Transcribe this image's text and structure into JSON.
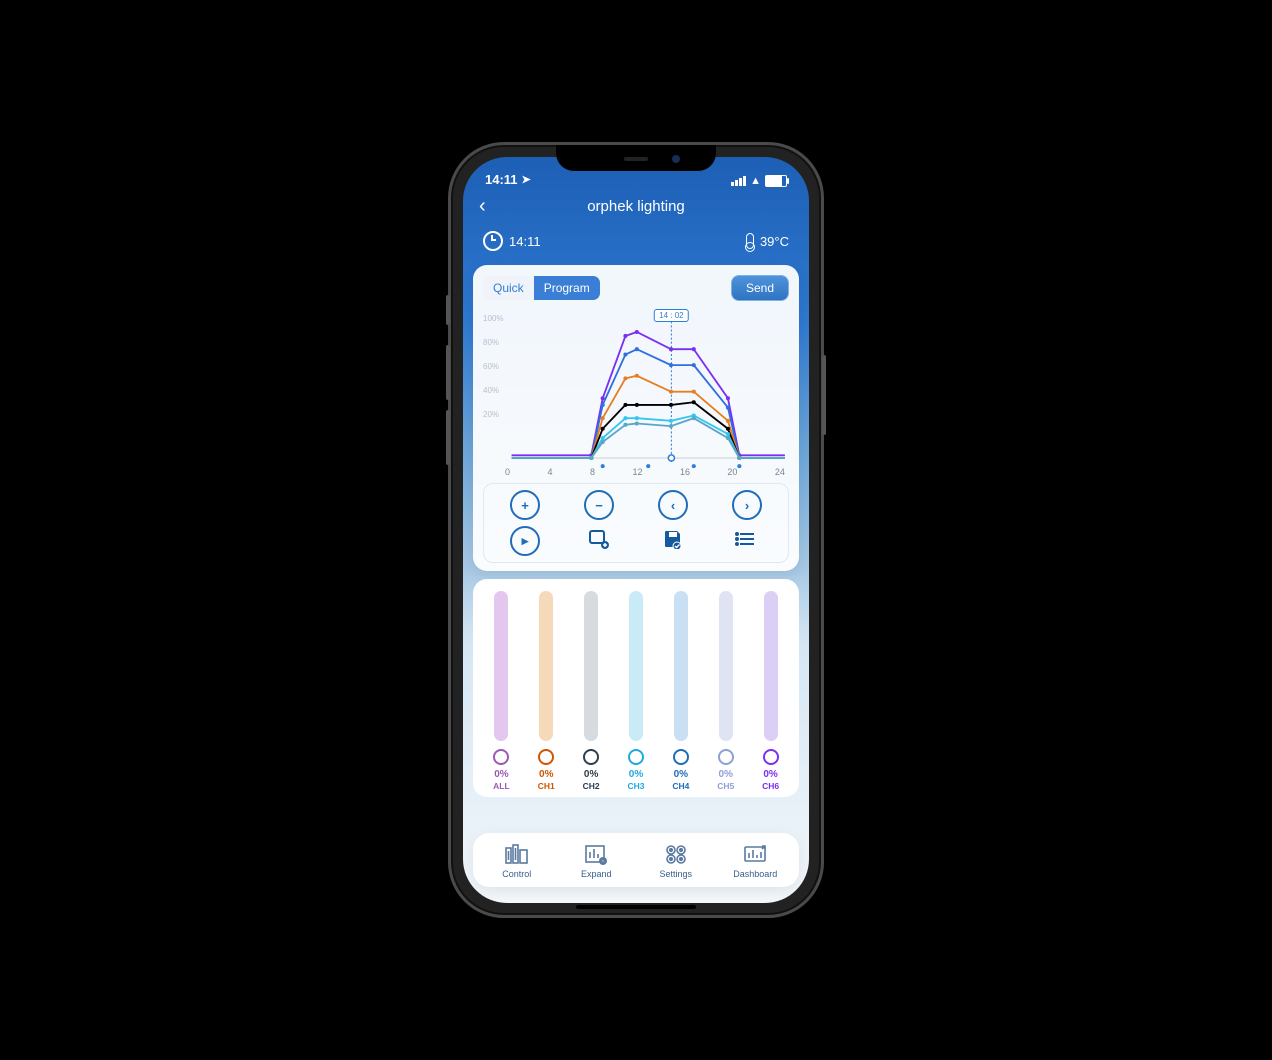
{
  "status": {
    "time": "14:11"
  },
  "header": {
    "title": "orphek lighting"
  },
  "info": {
    "time": "14:11",
    "temp": "39°C"
  },
  "tabs": {
    "quick": "Quick",
    "program": "Program",
    "active": "program"
  },
  "buttons": {
    "send": "Send"
  },
  "chart_data": {
    "type": "line",
    "xlabel": "",
    "ylabel": "",
    "xlim": [
      0,
      24
    ],
    "ylim": [
      0,
      100
    ],
    "x_ticks": [
      "0",
      "4",
      "8",
      "12",
      "16",
      "20",
      "24"
    ],
    "y_ticks": [
      "100%",
      "80%",
      "60%",
      "40%",
      "20%"
    ],
    "cursor": {
      "hour": 14,
      "minute": 2,
      "label": "14 : 02"
    },
    "anchor_hours": [
      7,
      8,
      10,
      11,
      14,
      16,
      19,
      20
    ],
    "stage_hours": [
      8,
      12,
      16,
      20
    ],
    "series": [
      {
        "name": "CH6",
        "color": "#7b2ff2",
        "x": [
          0,
          7,
          8,
          10,
          11,
          14,
          16,
          19,
          20,
          24
        ],
        "y": [
          2,
          2,
          45,
          92,
          95,
          82,
          82,
          45,
          2,
          2
        ]
      },
      {
        "name": "CH4",
        "color": "#2f6fe0",
        "x": [
          0,
          7,
          8,
          10,
          11,
          14,
          16,
          19,
          20,
          24
        ],
        "y": [
          0,
          0,
          40,
          78,
          82,
          70,
          70,
          38,
          0,
          0
        ]
      },
      {
        "name": "CH1",
        "color": "#e67e22",
        "x": [
          0,
          7,
          8,
          10,
          11,
          14,
          16,
          19,
          20,
          24
        ],
        "y": [
          0,
          0,
          30,
          60,
          62,
          50,
          50,
          28,
          0,
          0
        ]
      },
      {
        "name": "CH2",
        "color": "#000000",
        "x": [
          0,
          7,
          8,
          10,
          11,
          14,
          16,
          19,
          20,
          24
        ],
        "y": [
          0,
          0,
          22,
          40,
          40,
          40,
          42,
          22,
          0,
          0
        ]
      },
      {
        "name": "CH3",
        "color": "#35c6f0",
        "x": [
          0,
          7,
          8,
          10,
          11,
          14,
          16,
          19,
          20,
          24
        ],
        "y": [
          0,
          0,
          15,
          30,
          30,
          28,
          32,
          18,
          0,
          0
        ]
      },
      {
        "name": "CH5",
        "color": "#5aa6c4",
        "x": [
          0,
          7,
          8,
          10,
          11,
          14,
          16,
          19,
          20,
          24
        ],
        "y": [
          0,
          0,
          12,
          25,
          26,
          24,
          30,
          15,
          0,
          0
        ]
      }
    ]
  },
  "tools": {
    "row1": [
      "add-point",
      "remove-point",
      "prev-point",
      "next-point"
    ],
    "row2": [
      "play",
      "template-load",
      "save",
      "list"
    ]
  },
  "channels": [
    {
      "key": "ALL",
      "label": "ALL",
      "value": "0%",
      "color": "#9b59b6",
      "track": "#e3c7ef"
    },
    {
      "key": "CH1",
      "label": "CH1",
      "value": "0%",
      "color": "#d35400",
      "track": "#f6d9b8"
    },
    {
      "key": "CH2",
      "label": "CH2",
      "value": "0%",
      "color": "#2c3e50",
      "track": "#d7dbe0"
    },
    {
      "key": "CH3",
      "label": "CH3",
      "value": "0%",
      "color": "#1fa9e1",
      "track": "#c9ebf8"
    },
    {
      "key": "CH4",
      "label": "CH4",
      "value": "0%",
      "color": "#1f6cb8",
      "track": "#c9dff4"
    },
    {
      "key": "CH5",
      "label": "CH5",
      "value": "0%",
      "color": "#8e9fd9",
      "track": "#dfe3f4"
    },
    {
      "key": "CH6",
      "label": "CH6",
      "value": "0%",
      "color": "#7b2ff2",
      "track": "#dccff5"
    }
  ],
  "nav": {
    "control": "Control",
    "expand": "Expand",
    "settings": "Settings",
    "dashboard": "Dashboard"
  }
}
